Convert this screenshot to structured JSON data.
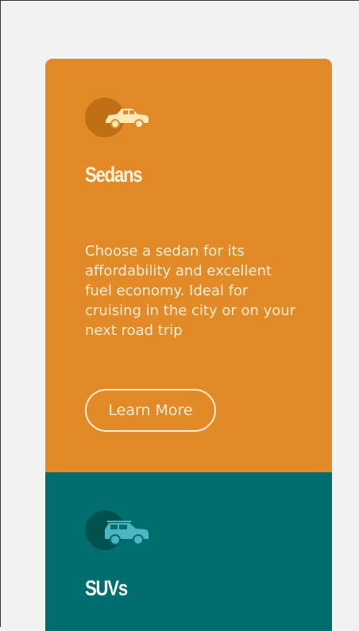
{
  "cards": [
    {
      "title": "Sedans",
      "icon": "sedan-icon",
      "description": "Choose a sedan for its affordability and excellent fuel economy. Ideal for cruising in the city or on your next road trip",
      "button_label": "Learn More",
      "background": "#e28a28"
    },
    {
      "title": "SUVs",
      "icon": "suv-icon",
      "background": "#006d6e"
    }
  ]
}
